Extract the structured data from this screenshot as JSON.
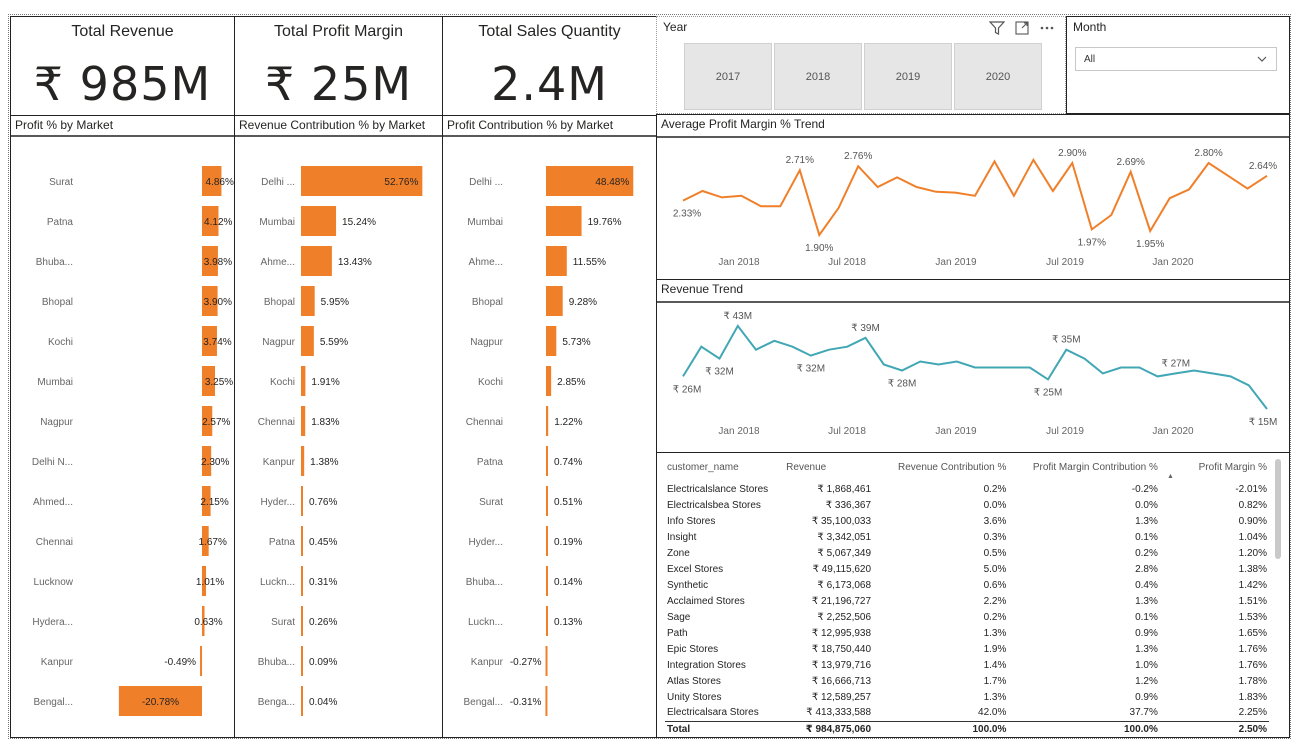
{
  "kpis": [
    {
      "title": "Total Revenue",
      "value": "₹ 985M"
    },
    {
      "title": "Total Profit Margin",
      "value": "₹ 25M"
    },
    {
      "title": "Total Sales Quantity",
      "value": "2.4M"
    }
  ],
  "year_slicer": {
    "title": "Year",
    "options": [
      "2017",
      "2018",
      "2019",
      "2020"
    ],
    "icons": [
      "filter-icon",
      "focus-mode-icon",
      "more-options-icon"
    ]
  },
  "month_slicer": {
    "title": "Month",
    "selected": "All"
  },
  "accent_color": "#F07F2A",
  "line_color_revenue": "#41A7B4",
  "chart_data": [
    {
      "type": "bar",
      "title": "Profit % by Market",
      "categories": [
        "Surat",
        "Patna",
        "Bhuba...",
        "Bhopal",
        "Kochi",
        "Mumbai",
        "Nagpur",
        "Delhi N...",
        "Ahmed...",
        "Chennai",
        "Lucknow",
        "Hydera...",
        "Kanpur",
        "Bengal..."
      ],
      "values": [
        4.86,
        4.12,
        3.98,
        3.9,
        3.74,
        3.25,
        2.57,
        2.3,
        2.15,
        1.67,
        1.01,
        0.63,
        -0.49,
        -20.78
      ],
      "labels": [
        "4.86%",
        "4.12%",
        "3.98%",
        "3.90%",
        "3.74%",
        "3.25%",
        "2.57%",
        "2.30%",
        "2.15%",
        "1.67%",
        "1.01%",
        "0.63%",
        "-0.49%",
        "-20.78%"
      ],
      "color": "#F07F2A"
    },
    {
      "type": "bar",
      "title": "Revenue Contribution % by Market",
      "categories": [
        "Delhi ...",
        "Mumbai",
        "Ahme...",
        "Bhopal",
        "Nagpur",
        "Kochi",
        "Chennai",
        "Kanpur",
        "Hyder...",
        "Patna",
        "Luckn...",
        "Surat",
        "Bhuba...",
        "Benga..."
      ],
      "values": [
        52.76,
        15.24,
        13.43,
        5.95,
        5.59,
        1.91,
        1.83,
        1.38,
        0.76,
        0.45,
        0.31,
        0.26,
        0.09,
        0.04
      ],
      "labels": [
        "52.76%",
        "15.24%",
        "13.43%",
        "5.95%",
        "5.59%",
        "1.91%",
        "1.83%",
        "1.38%",
        "0.76%",
        "0.45%",
        "0.31%",
        "0.26%",
        "0.09%",
        "0.04%"
      ],
      "color": "#F07F2A"
    },
    {
      "type": "bar",
      "title": "Profit Contribution % by Market",
      "categories": [
        "Delhi ...",
        "Mumbai",
        "Ahme...",
        "Bhopal",
        "Nagpur",
        "Kochi",
        "Chennai",
        "Patna",
        "Surat",
        "Hyder...",
        "Bhuba...",
        "Luckn...",
        "Kanpur",
        "Bengal..."
      ],
      "values": [
        48.48,
        19.76,
        11.55,
        9.28,
        5.73,
        2.85,
        1.22,
        0.74,
        0.51,
        0.19,
        0.14,
        0.13,
        -0.27,
        -0.31
      ],
      "labels": [
        "48.48%",
        "19.76%",
        "11.55%",
        "9.28%",
        "5.73%",
        "2.85%",
        "1.22%",
        "0.74%",
        "0.51%",
        "0.19%",
        "0.14%",
        "0.13%",
        "-0.27%",
        "-0.31%"
      ],
      "color": "#F07F2A"
    },
    {
      "type": "line",
      "title": "Average Profit Margin % Trend",
      "x_ticks": [
        "Jan 2018",
        "Jul 2018",
        "Jan 2019",
        "Jul 2019",
        "Jan 2020"
      ],
      "x": [
        "2017-10",
        "2017-11",
        "2017-12",
        "2018-01",
        "2018-02",
        "2018-03",
        "2018-04",
        "2018-05",
        "2018-06",
        "2018-07",
        "2018-08",
        "2018-09",
        "2018-10",
        "2018-11",
        "2018-12",
        "2019-01",
        "2019-02",
        "2019-03",
        "2019-04",
        "2019-05",
        "2019-06",
        "2019-07",
        "2019-08",
        "2019-09",
        "2019-10",
        "2019-11",
        "2019-12",
        "2020-01",
        "2020-02",
        "2020-03",
        "2020-04",
        "2020-05",
        "2020-06"
      ],
      "values": [
        2.33,
        2.45,
        2.37,
        2.39,
        2.26,
        2.26,
        2.71,
        1.9,
        2.24,
        2.76,
        2.5,
        2.62,
        2.5,
        2.44,
        2.43,
        2.39,
        2.82,
        2.39,
        2.84,
        2.45,
        2.8,
        1.97,
        2.15,
        2.69,
        1.95,
        2.36,
        2.47,
        2.8,
        2.64,
        2.48,
        2.64
      ],
      "point_labels": [
        {
          "index": 0,
          "text": "2.33%"
        },
        {
          "index": 6,
          "text": "2.71%"
        },
        {
          "index": 7,
          "text": "1.90%"
        },
        {
          "index": 9,
          "text": "2.76%"
        },
        {
          "index": 20,
          "text": "2.90%"
        },
        {
          "index": 21,
          "text": "1.97%"
        },
        {
          "index": 23,
          "text": "2.69%"
        },
        {
          "index": 24,
          "text": "1.95%"
        },
        {
          "index": 27,
          "text": "2.80%"
        },
        {
          "index": 30,
          "text": "2.64%"
        }
      ],
      "color": "#F07F2A"
    },
    {
      "type": "line",
      "title": "Revenue Trend",
      "x_ticks": [
        "Jan 2018",
        "Jul 2018",
        "Jan 2019",
        "Jul 2019",
        "Jan 2020"
      ],
      "values": [
        26,
        36,
        32,
        43,
        35,
        38,
        36,
        33,
        35,
        36,
        39,
        30,
        28,
        31,
        30,
        31,
        29,
        29,
        29,
        29,
        25,
        35,
        32,
        27,
        29,
        29,
        26,
        27,
        28,
        27,
        26,
        23,
        15
      ],
      "unit": "₹ M",
      "point_labels": [
        {
          "index": 0,
          "text": "₹ 26M"
        },
        {
          "index": 2,
          "text": "₹ 32M"
        },
        {
          "index": 3,
          "text": "₹ 43M"
        },
        {
          "index": 7,
          "text": "₹ 32M"
        },
        {
          "index": 10,
          "text": "₹ 39M"
        },
        {
          "index": 12,
          "text": "₹ 28M"
        },
        {
          "index": 20,
          "text": "₹ 25M"
        },
        {
          "index": 21,
          "text": "₹ 35M"
        },
        {
          "index": 27,
          "text": "₹ 27M"
        },
        {
          "index": 32,
          "text": "₹ 15M"
        }
      ],
      "color": "#41A7B4"
    }
  ],
  "customer_table": {
    "columns": [
      "customer_name",
      "Revenue",
      "Revenue Contribution %",
      "Profit Margin Contribution %",
      "Profit Margin %"
    ],
    "rows": [
      [
        "Electricalslance Stores",
        "₹ 1,868,461",
        "0.2%",
        "-0.2%",
        "-2.01%"
      ],
      [
        "Electricalsbea Stores",
        "₹ 336,367",
        "0.0%",
        "0.0%",
        "0.82%"
      ],
      [
        "Info Stores",
        "₹ 35,100,033",
        "3.6%",
        "1.3%",
        "0.90%"
      ],
      [
        "Insight",
        "₹ 3,342,051",
        "0.3%",
        "0.1%",
        "1.04%"
      ],
      [
        "Zone",
        "₹ 5,067,349",
        "0.5%",
        "0.2%",
        "1.20%"
      ],
      [
        "Excel Stores",
        "₹ 49,115,620",
        "5.0%",
        "2.8%",
        "1.38%"
      ],
      [
        "Synthetic",
        "₹ 6,173,068",
        "0.6%",
        "0.4%",
        "1.42%"
      ],
      [
        "Acclaimed Stores",
        "₹ 21,196,727",
        "2.2%",
        "1.3%",
        "1.51%"
      ],
      [
        "Sage",
        "₹ 2,252,506",
        "0.2%",
        "0.1%",
        "1.53%"
      ],
      [
        "Path",
        "₹ 12,995,938",
        "1.3%",
        "0.9%",
        "1.65%"
      ],
      [
        "Epic Stores",
        "₹ 18,750,440",
        "1.9%",
        "1.3%",
        "1.76%"
      ],
      [
        "Integration Stores",
        "₹ 13,979,716",
        "1.4%",
        "1.0%",
        "1.76%"
      ],
      [
        "Atlas Stores",
        "₹ 16,666,713",
        "1.7%",
        "1.2%",
        "1.78%"
      ],
      [
        "Unity Stores",
        "₹ 12,589,257",
        "1.3%",
        "0.9%",
        "1.83%"
      ],
      [
        "Electricalsara Stores",
        "₹ 413,333,588",
        "42.0%",
        "37.7%",
        "2.25%"
      ]
    ],
    "total": [
      "Total",
      "₹ 984,875,060",
      "100.0%",
      "100.0%",
      "2.50%"
    ]
  }
}
